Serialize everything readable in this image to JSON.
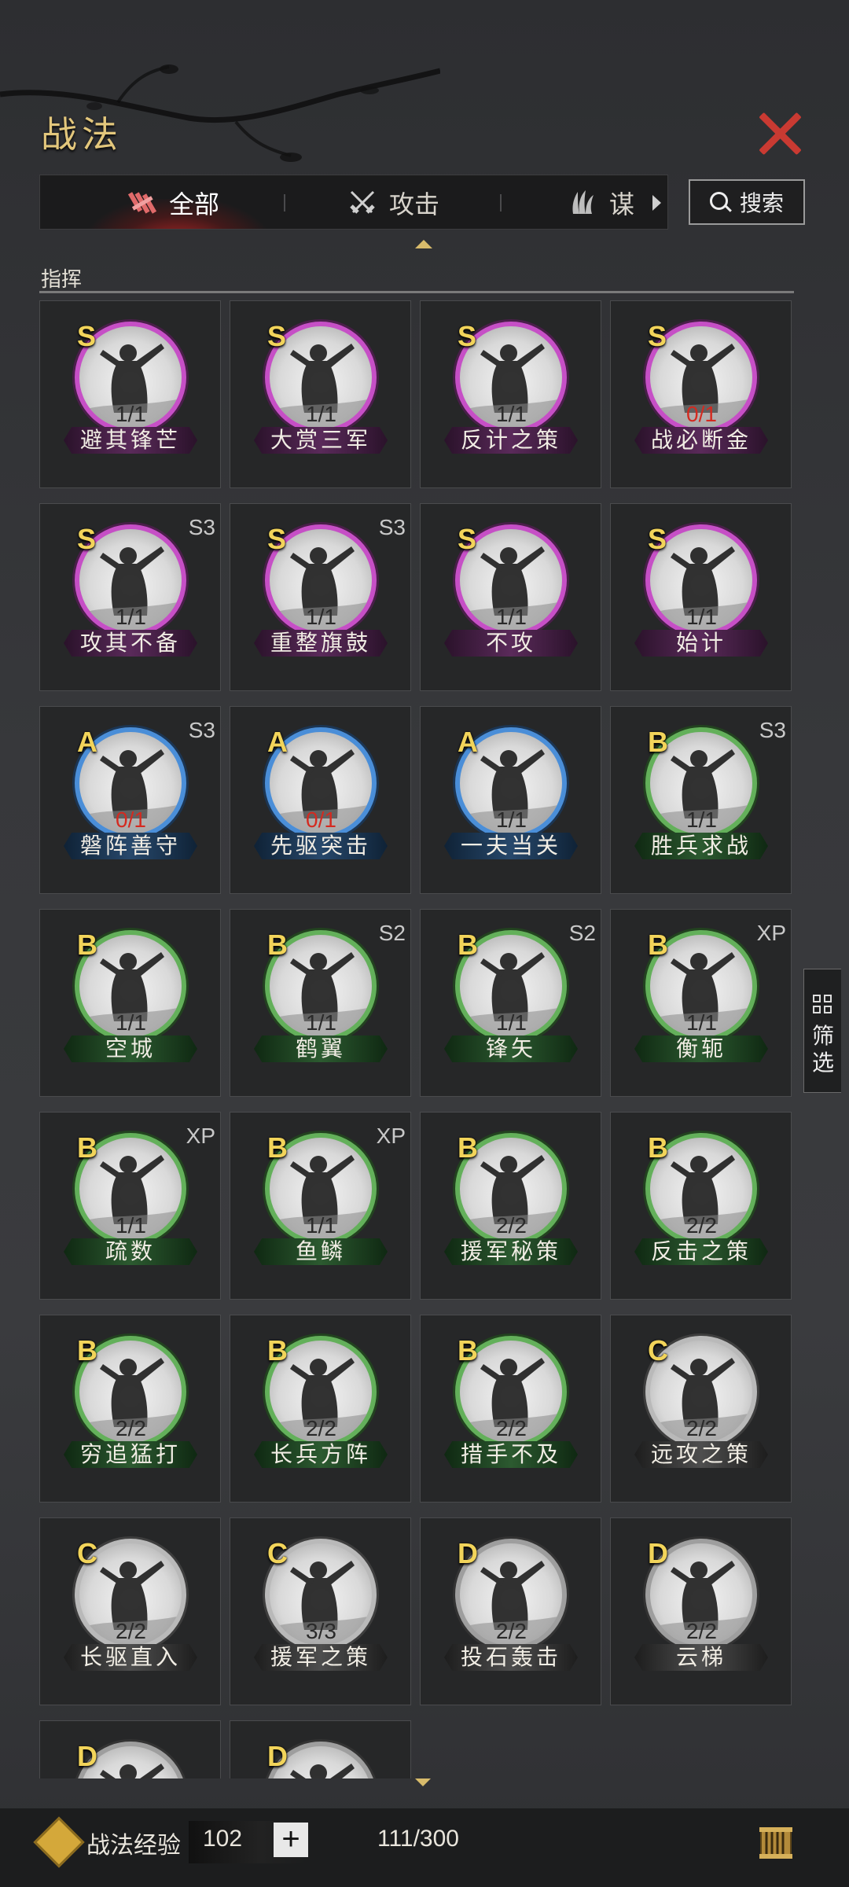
{
  "header": {
    "title": "战法"
  },
  "tabs": [
    {
      "label": "全部",
      "icon": "bundle-icon",
      "active": true
    },
    {
      "label": "攻击",
      "icon": "crossed-swords-icon",
      "active": false
    },
    {
      "label": "谋",
      "icon": "claw-icon",
      "active": false
    }
  ],
  "search": {
    "label": "搜索"
  },
  "section": {
    "title": "指挥"
  },
  "skills": [
    {
      "grade": "S",
      "count": "1/1",
      "name": "避其锋芒",
      "badge": "",
      "count_red": false
    },
    {
      "grade": "S",
      "count": "1/1",
      "name": "大赏三军",
      "badge": "",
      "count_red": false
    },
    {
      "grade": "S",
      "count": "1/1",
      "name": "反计之策",
      "badge": "",
      "count_red": false
    },
    {
      "grade": "S",
      "count": "0/1",
      "name": "战必断金",
      "badge": "",
      "count_red": true
    },
    {
      "grade": "S",
      "count": "1/1",
      "name": "攻其不备",
      "badge": "S3",
      "count_red": false
    },
    {
      "grade": "S",
      "count": "1/1",
      "name": "重整旗鼓",
      "badge": "S3",
      "count_red": false
    },
    {
      "grade": "S",
      "count": "1/1",
      "name": "不攻",
      "badge": "",
      "count_red": false
    },
    {
      "grade": "S",
      "count": "1/1",
      "name": "始计",
      "badge": "",
      "count_red": false
    },
    {
      "grade": "A",
      "count": "0/1",
      "name": "磐阵善守",
      "badge": "S3",
      "count_red": true
    },
    {
      "grade": "A",
      "count": "0/1",
      "name": "先驱突击",
      "badge": "",
      "count_red": true
    },
    {
      "grade": "A",
      "count": "1/1",
      "name": "一夫当关",
      "badge": "",
      "count_red": false
    },
    {
      "grade": "B",
      "count": "1/1",
      "name": "胜兵求战",
      "badge": "S3",
      "count_red": false
    },
    {
      "grade": "B",
      "count": "1/1",
      "name": "空城",
      "badge": "",
      "count_red": false
    },
    {
      "grade": "B",
      "count": "1/1",
      "name": "鹤翼",
      "badge": "S2",
      "count_red": false
    },
    {
      "grade": "B",
      "count": "1/1",
      "name": "锋矢",
      "badge": "S2",
      "count_red": false
    },
    {
      "grade": "B",
      "count": "1/1",
      "name": "衡轭",
      "badge": "XP",
      "count_red": false
    },
    {
      "grade": "B",
      "count": "1/1",
      "name": "疏数",
      "badge": "XP",
      "count_red": false
    },
    {
      "grade": "B",
      "count": "1/1",
      "name": "鱼鳞",
      "badge": "XP",
      "count_red": false
    },
    {
      "grade": "B",
      "count": "2/2",
      "name": "援军秘策",
      "badge": "",
      "count_red": false
    },
    {
      "grade": "B",
      "count": "2/2",
      "name": "反击之策",
      "badge": "",
      "count_red": false
    },
    {
      "grade": "B",
      "count": "2/2",
      "name": "穷追猛打",
      "badge": "",
      "count_red": false
    },
    {
      "grade": "B",
      "count": "2/2",
      "name": "长兵方阵",
      "badge": "",
      "count_red": false
    },
    {
      "grade": "B",
      "count": "2/2",
      "name": "措手不及",
      "badge": "",
      "count_red": false
    },
    {
      "grade": "C",
      "count": "2/2",
      "name": "远攻之策",
      "badge": "",
      "count_red": false
    },
    {
      "grade": "C",
      "count": "2/2",
      "name": "长驱直入",
      "badge": "",
      "count_red": false
    },
    {
      "grade": "C",
      "count": "3/3",
      "name": "援军之策",
      "badge": "",
      "count_red": false
    },
    {
      "grade": "D",
      "count": "2/2",
      "name": "投石轰击",
      "badge": "",
      "count_red": false
    },
    {
      "grade": "D",
      "count": "2/2",
      "name": "云梯",
      "badge": "",
      "count_red": false
    },
    {
      "grade": "D",
      "count": "",
      "name": "",
      "badge": "",
      "count_red": false
    },
    {
      "grade": "D",
      "count": "",
      "name": "",
      "badge": "",
      "count_red": false
    }
  ],
  "filter": {
    "label": "筛选"
  },
  "footer": {
    "xp_label": "战法经验",
    "xp_value": "102",
    "plus": "+",
    "capacity": "111/300"
  },
  "colors": {
    "grade_S": "#c64fc6",
    "grade_A": "#4a8ed8",
    "grade_B": "#63b05a",
    "grade_C": "#b9b9b9",
    "grade_D": "#9e9e9e",
    "accent": "#e3c77c",
    "close": "#c93a32",
    "red_count": "#d42a20"
  }
}
